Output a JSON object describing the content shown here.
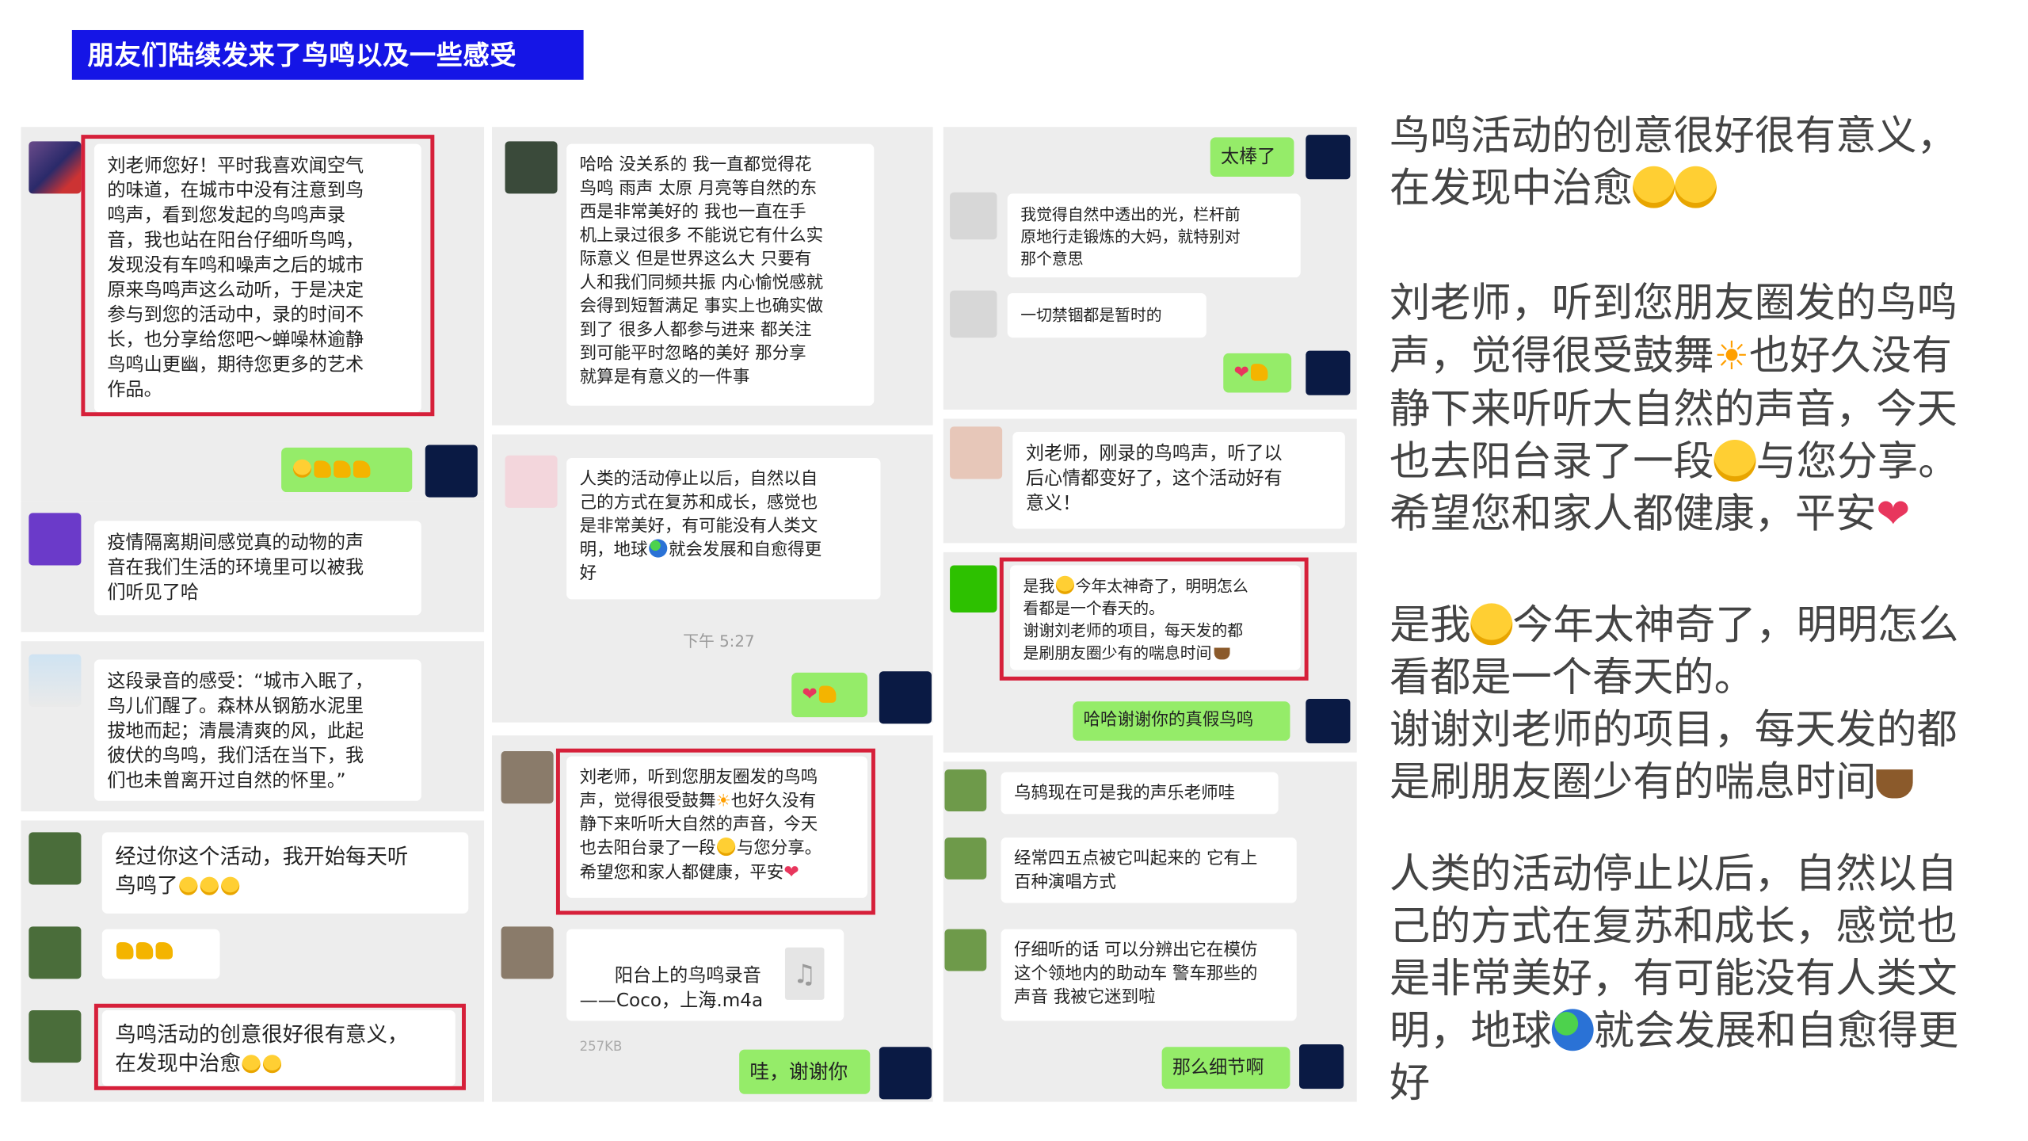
{
  "banner_title": "朋友们陆续发来了鸟鸣以及一些感受",
  "colors": {
    "banner_bg": "#1515e6",
    "wechat_green": "#95ec69",
    "highlight_red": "#d6203a"
  },
  "col1": {
    "msg1": "刘老师您好！平时我喜欢闻空气\n的味道，在城市中没有注意到鸟\n鸣声，看到您发起的鸟鸣声录\n音，我也站在阳台仔细听鸟鸣，\n发现没有车鸣和噪声之后的城市\n原来鸟鸣声这么动听，于是决定\n参与到您的活动中，录的时间不\n长，也分享给您吧～蝉噪林逾静\n鸟鸣山更幽，期待您更多的艺术\n作品。",
    "msg2": "疫情隔离期间感觉真的动物的声\n音在我们生活的环境里可以被我\n们听见了哈",
    "msg3": "这段录音的感受：“城市入眠了，\n鸟儿们醒了。森林从钢筋水泥里\n拔地而起；清晨清爽的风，此起\n彼伏的鸟鸣，我们活在当下，我\n们也未曾离开过自然的怀里。”",
    "msg4": "经过你这个活动，我开始每天听\n鸟鸣了",
    "msg5": "鸟鸣活动的创意很好很有意义，\n在发现中治愈"
  },
  "col2": {
    "msg1": "哈哈 没关系的 我一直都觉得花\n鸟鸣 雨声 太原 月亮等自然的东\n西是非常美好的 我也一直在手\n机上录过很多 不能说它有什么实\n际意义 但是世界这么大 只要有\n人和我们同频共振 内心愉悦感就\n会得到短暂满足 事实上也确实做\n到了 很多人都参与进来 都关注\n到可能平时忽略的美好 那分享\n就算是有意义的一件事",
    "msg2": "人类的活动停止以后，自然以自\n己的方式在复苏和成长，感觉也\n是非常美好，有可能没有人类文\n明，地球",
    "msg2b": "就会发展和自愈得更\n好",
    "timestamp": "下午 5:27",
    "msg3a": "刘老师，听到您朋友圈发的鸟鸣\n声，觉得很受鼓舞",
    "msg3b": "也好久没有\n静下来听听大自然的声音，今天\n也去阳台录了一段",
    "msg3c": "与您分享。\n希望您和家人都健康，平安",
    "file_name": "阳台上的鸟鸣录音\n——Coco，上海.m4a",
    "file_size": "257KB",
    "reply": "哇，谢谢你"
  },
  "col3": {
    "reply1": "太棒了",
    "msg1": "我觉得自然中透出的光，栏杆前\n原地行走锻炼的大妈，就特别对\n那个意思",
    "msg2": "一切禁锢都是暂时的",
    "msg3": "刘老师，刚录的鸟鸣声，听了以\n后心情都变好了，这个活动好有\n意义！",
    "msg4a": "是我",
    "msg4b": "今年太神奇了，明明怎么\n看都是一个春天的。\n谢谢刘老师的项目，每天发的都\n是刷朋友圈少有的喘息时间",
    "reply2": "哈哈谢谢你的真假鸟鸣",
    "msg5": "乌鸫现在可是我的声乐老师哇",
    "msg6": "经常四五点被它叫起来的 它有上\n百种演唱方式",
    "msg7": "仔细听的话 可以分辨出它在模仿\n这个领地内的助动车 警车那些的\n声音 我被它迷到啦",
    "reply3": "那么细节啊"
  },
  "quotes": {
    "q1a": "鸟鸣活动的创意很好很有意义，\n在发现中治愈",
    "q2a": "刘老师，听到您朋友圈发的鸟鸣\n声，觉得很受鼓舞",
    "q2b": "也好久没有\n静下来听听大自然的声音，今天\n也去阳台录了一段",
    "q2c": "与您分享。\n希望您和家人都健康，平安",
    "q3a": "是我",
    "q3b": "今年太神奇了，明明怎么\n看都是一个春天的。\n谢谢刘老师的项目，每天发的都\n是刷朋友圈少有的喘息时间",
    "q4a": "人类的活动停止以后，自然以自\n己的方式在复苏和成长，感觉也\n是非常美好，有可能没有人类文\n明，地球",
    "q4b": "就会发展和自愈得更\n好"
  }
}
